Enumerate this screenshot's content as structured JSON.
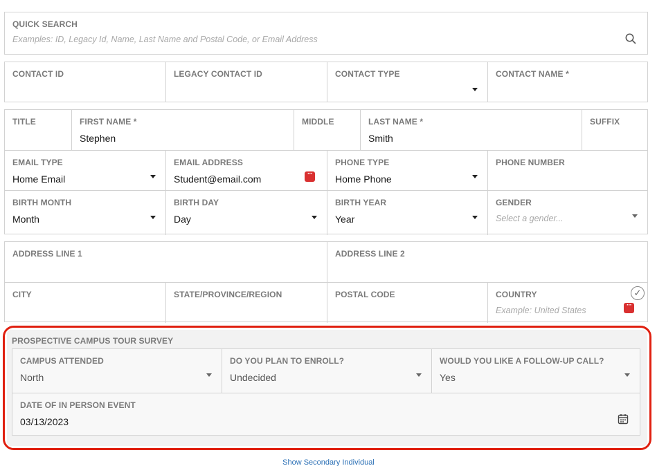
{
  "quick_search": {
    "label": "QUICK SEARCH",
    "placeholder": "Examples: ID, Legacy Id, Name, Last Name and Postal Code, or Email Address"
  },
  "contact_row": {
    "contact_id": {
      "label": "CONTACT ID",
      "value": ""
    },
    "legacy_contact_id": {
      "label": "LEGACY CONTACT ID",
      "value": ""
    },
    "contact_type": {
      "label": "CONTACT TYPE",
      "value": ""
    },
    "contact_name": {
      "label": "CONTACT NAME *",
      "value": ""
    }
  },
  "name_row": {
    "title": {
      "label": "TITLE",
      "value": ""
    },
    "first_name": {
      "label": "FIRST NAME *",
      "value": "Stephen"
    },
    "middle": {
      "label": "MIDDLE",
      "value": ""
    },
    "last_name": {
      "label": "LAST NAME *",
      "value": "Smith"
    },
    "suffix": {
      "label": "SUFFIX",
      "value": ""
    }
  },
  "email_row": {
    "email_type": {
      "label": "EMAIL TYPE",
      "value": "Home Email"
    },
    "email_address": {
      "label": "EMAIL ADDRESS",
      "value": "Student@email.com"
    },
    "phone_type": {
      "label": "PHONE TYPE",
      "value": "Home Phone"
    },
    "phone_number": {
      "label": "PHONE NUMBER",
      "value": ""
    }
  },
  "birth_row": {
    "birth_month": {
      "label": "BIRTH MONTH",
      "value": "Month"
    },
    "birth_day": {
      "label": "BIRTH DAY",
      "value": "Day"
    },
    "birth_year": {
      "label": "BIRTH YEAR",
      "value": "Year"
    },
    "gender": {
      "label": "GENDER",
      "placeholder": "Select a gender..."
    }
  },
  "address_row": {
    "address_line_1": {
      "label": "ADDRESS LINE 1",
      "value": ""
    },
    "address_line_2": {
      "label": "ADDRESS LINE 2",
      "value": ""
    }
  },
  "city_row": {
    "city": {
      "label": "CITY",
      "value": ""
    },
    "state": {
      "label": "STATE/PROVINCE/REGION",
      "value": ""
    },
    "postal_code": {
      "label": "POSTAL CODE",
      "value": ""
    },
    "country": {
      "label": "COUNTRY",
      "placeholder": "Example: United States"
    }
  },
  "survey": {
    "title": "PROSPECTIVE CAMPUS TOUR SURVEY",
    "campus_attended": {
      "label": "CAMPUS ATTENDED",
      "value": "North"
    },
    "plan_to_enroll": {
      "label": "DO YOU PLAN TO ENROLL?",
      "value": "Undecided"
    },
    "follow_up_call": {
      "label": "WOULD YOU LIKE A FOLLOW-UP CALL?",
      "value": "Yes"
    },
    "event_date": {
      "label": "DATE OF IN PERSON EVENT",
      "value": "03/13/2023"
    }
  },
  "footer": {
    "secondary_link": "Show Secondary Individual"
  },
  "colors": {
    "highlight": "#e02010",
    "error_icon": "#d93030",
    "link": "#2a6fb5"
  }
}
